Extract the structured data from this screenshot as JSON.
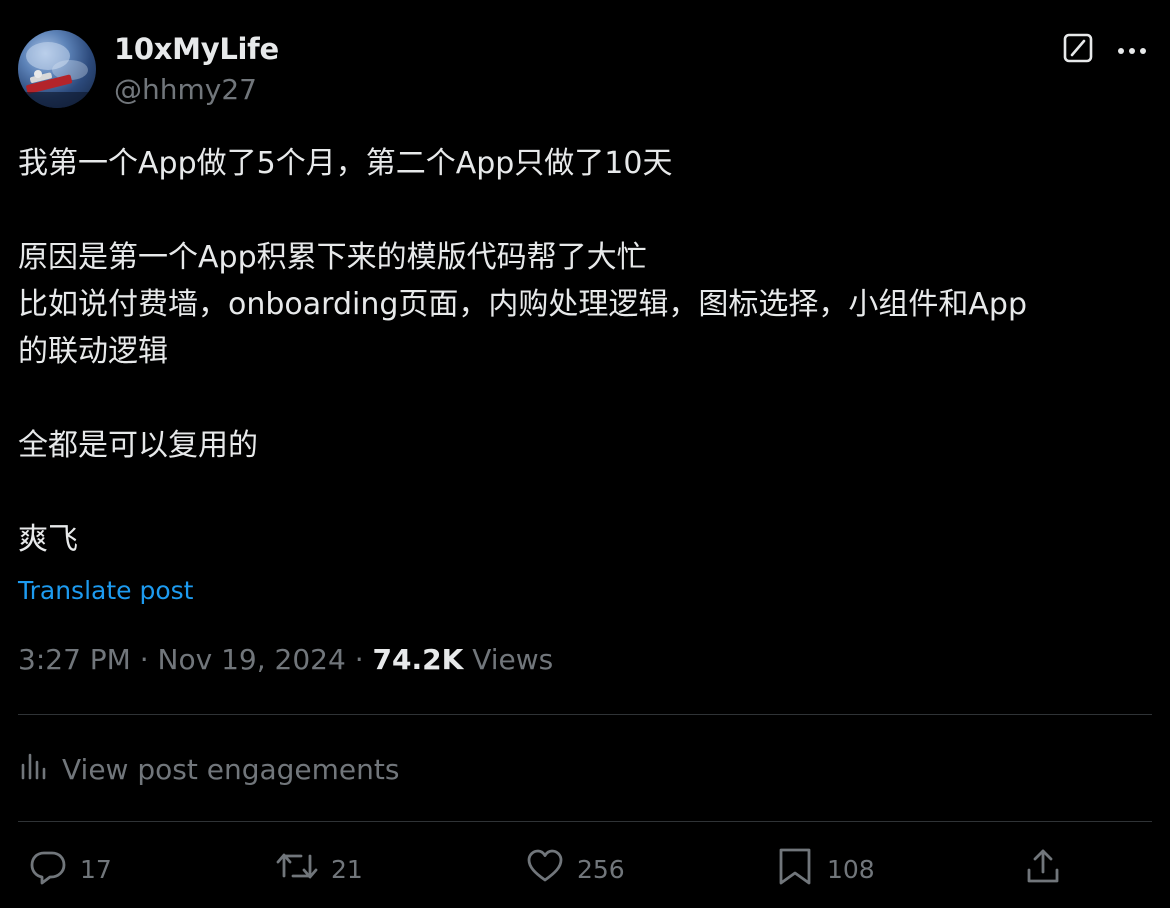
{
  "author": {
    "name": "10xMyLife",
    "handle": "@hhmy27"
  },
  "post": {
    "lines": [
      "我第一个App做了5个月，第二个App只做了10天",
      "原因是第一个App积累下来的模版代码帮了大忙",
      "比如说付费墙，onboarding页面，内购处理逻辑，图标选择，小组件和App",
      "的联动逻辑",
      "全都是可以复用的",
      "爽飞"
    ],
    "translate_label": "Translate post"
  },
  "meta": {
    "time": "3:27 PM",
    "separator": "·",
    "date": "Nov 19, 2024",
    "views_count": "74.2K",
    "views_label": "Views"
  },
  "engagements_label": "View post engagements",
  "actions": {
    "replies": "17",
    "reposts": "21",
    "likes": "256",
    "bookmarks": "108"
  },
  "icons": {
    "grok": "grok-icon",
    "more": "more-icon",
    "analytics": "analytics-icon",
    "reply": "reply-icon",
    "repost": "repost-icon",
    "like": "heart-icon",
    "bookmark": "bookmark-icon",
    "share": "share-icon"
  },
  "colors": {
    "background": "#000000",
    "text": "#e7e9ea",
    "secondary": "#71767b",
    "link": "#1d9bf0",
    "divider": "#2f3336"
  }
}
